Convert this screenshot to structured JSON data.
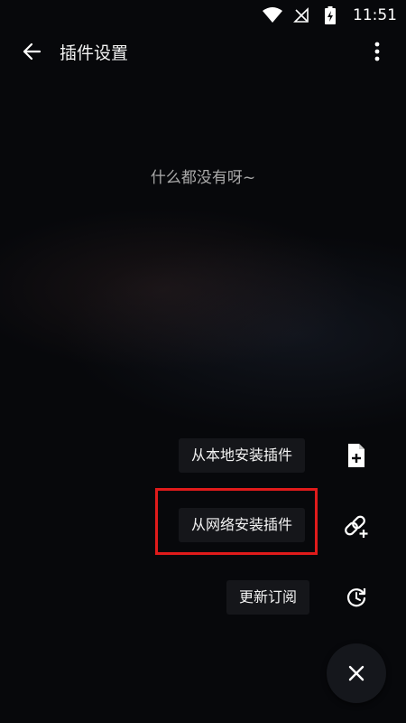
{
  "status_bar": {
    "time": "11:51"
  },
  "toolbar": {
    "title": "插件设置"
  },
  "empty_state": {
    "text": "什么都没有呀~"
  },
  "fab_menu": {
    "items": [
      {
        "label": "从本地安装插件",
        "icon": "file-add-icon"
      },
      {
        "label": "从网络安装插件",
        "icon": "link-add-icon"
      },
      {
        "label": "更新订阅",
        "icon": "refresh-icon"
      }
    ],
    "close_icon": "close-icon"
  },
  "colors": {
    "background": "#07080b",
    "highlight": "#e01b1b",
    "label_bg": "#15161a"
  }
}
